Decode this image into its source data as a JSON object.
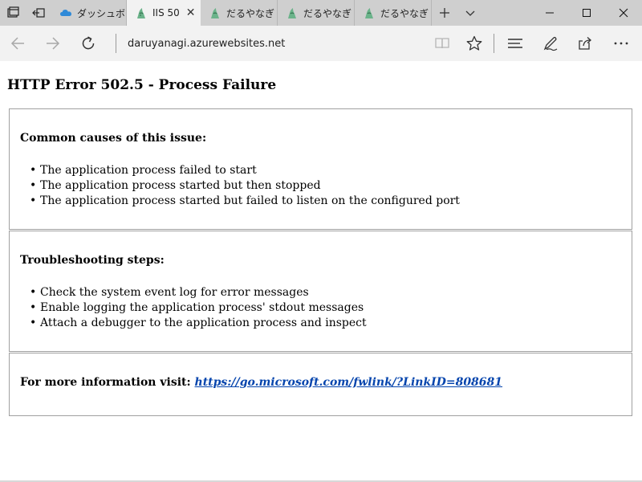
{
  "tabs": [
    {
      "label": "ダッシュボー",
      "icon": "azure-cloud-icon",
      "active": false
    },
    {
      "label": "IIS 50",
      "icon": "darumayanagi-favicon",
      "active": true
    },
    {
      "label": "だるやなぎ",
      "icon": "darumayanagi-favicon",
      "active": false
    },
    {
      "label": "だるやなぎ",
      "icon": "darumayanagi-favicon",
      "active": false
    },
    {
      "label": "だるやなぎ",
      "icon": "darumayanagi-favicon",
      "active": false
    }
  ],
  "address": {
    "url": "daruyanagi.azurewebsites.net"
  },
  "page": {
    "title": "HTTP Error 502.5 - Process Failure",
    "causes": {
      "heading": "Common causes of this issue:",
      "items": [
        "The application process failed to start",
        "The application process started but then stopped",
        "The application process started but failed to listen on the configured port"
      ]
    },
    "troubleshooting": {
      "heading": "Troubleshooting steps:",
      "items": [
        "Check the system event log for error messages",
        "Enable logging the application process' stdout messages",
        "Attach a debugger to the application process and inspect"
      ]
    },
    "more_info": {
      "label": "For more information visit:",
      "link": "https://go.microsoft.com/fwlink/?LinkID=808681"
    }
  },
  "colors": {
    "link": "#0645ad",
    "tabstrip_bg": "#cfcfcf",
    "toolbar_bg": "#f2f2f2",
    "panel_border": "#a0a0a0",
    "azure_blue": "#2f8ad8",
    "favicon_green": "#6bb38a"
  }
}
